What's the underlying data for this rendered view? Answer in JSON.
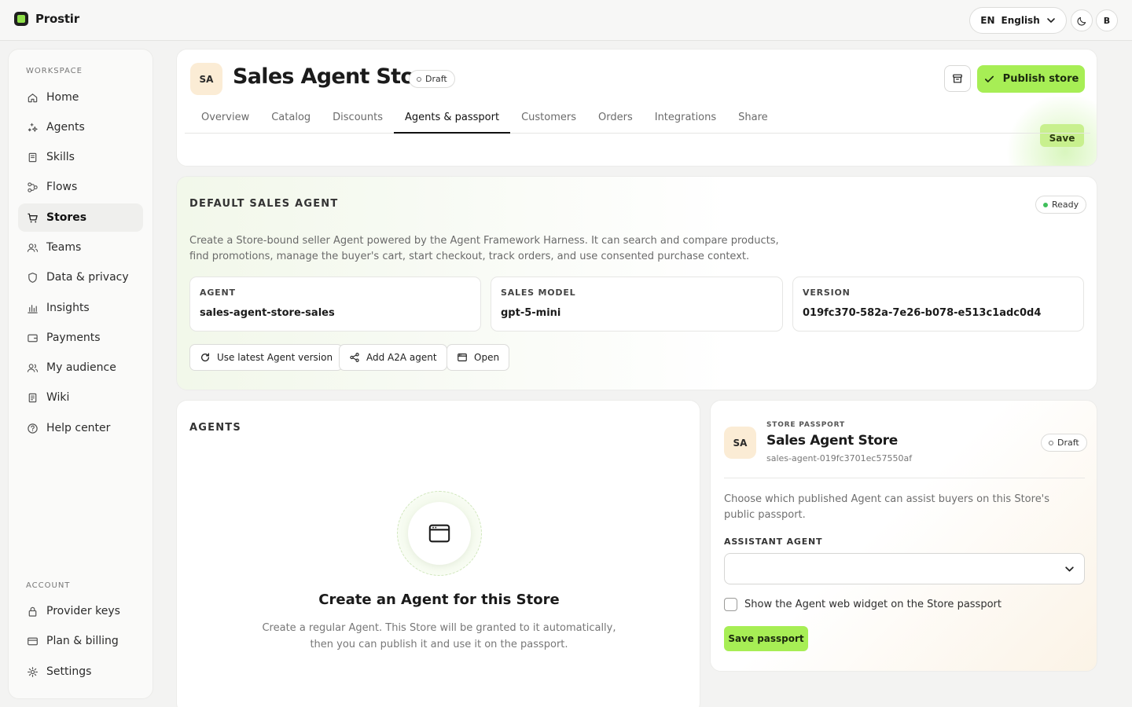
{
  "app": {
    "name": "Prostir"
  },
  "topbar": {
    "lang_code": "EN",
    "lang_label": "English",
    "user_initial": "B"
  },
  "sidebar": {
    "workspace_label": "WORKSPACE",
    "account_label": "ACCOUNT",
    "items": [
      {
        "label": "Home",
        "icon": "home-icon"
      },
      {
        "label": "Agents",
        "icon": "sparkle-icon"
      },
      {
        "label": "Skills",
        "icon": "book-icon"
      },
      {
        "label": "Flows",
        "icon": "flow-icon"
      },
      {
        "label": "Stores",
        "icon": "cart-icon",
        "active": true
      },
      {
        "label": "Teams",
        "icon": "users-icon"
      },
      {
        "label": "Data & privacy",
        "icon": "shield-icon"
      },
      {
        "label": "Insights",
        "icon": "bar-chart-icon"
      },
      {
        "label": "Payments",
        "icon": "wallet-icon"
      },
      {
        "label": "My audience",
        "icon": "users-icon"
      },
      {
        "label": "Wiki",
        "icon": "book-icon"
      },
      {
        "label": "Help center",
        "icon": "help-icon"
      }
    ],
    "account_items": [
      {
        "label": "Provider keys",
        "icon": "lock-icon"
      },
      {
        "label": "Plan & billing",
        "icon": "card-icon"
      },
      {
        "label": "Settings",
        "icon": "gear-icon"
      }
    ]
  },
  "store": {
    "initials": "SA",
    "title": "Sales Agent Store",
    "status": "Draft",
    "publish_label": "Publish store",
    "save_label": "Save",
    "tabs": [
      "Overview",
      "Catalog",
      "Discounts",
      "Agents & passport",
      "Customers",
      "Orders",
      "Integrations",
      "Share"
    ],
    "active_tab": "Agents & passport"
  },
  "default_agent": {
    "title": "DEFAULT SALES AGENT",
    "status": "Ready",
    "description": "Create a Store-bound seller Agent powered by the Agent Framework Harness. It can search and compare products, find promotions, manage the buyer's cart, start checkout, track orders, and use consented purchase context.",
    "agent_label": "AGENT",
    "agent_value": "sales-agent-store-sales",
    "model_label": "SALES MODEL",
    "model_value": "gpt-5-mini",
    "version_label": "VERSION",
    "version_value": "019fc370-582a-7e26-b078-e513c1adc0d4",
    "btn_latest": "Use latest Agent version",
    "btn_a2a": "Add A2A agent",
    "btn_open": "Open"
  },
  "agents": {
    "title": "AGENTS",
    "empty_title": "Create an Agent for this Store",
    "empty_desc": "Create a regular Agent. This Store will be granted to it automatically, then you can publish it and use it on the passport."
  },
  "passport": {
    "kicker": "STORE PASSPORT",
    "initials": "SA",
    "name": "Sales Agent Store",
    "slug": "sales-agent-019fc3701ec57550af",
    "status": "Draft",
    "description": "Choose which published Agent can assist buyers on this Store's public passport.",
    "assistant_label": "ASSISTANT AGENT",
    "assistant_value": "",
    "widget_label": "Show the Agent web widget on the Store passport",
    "widget_checked": false,
    "save_label": "Save passport"
  }
}
